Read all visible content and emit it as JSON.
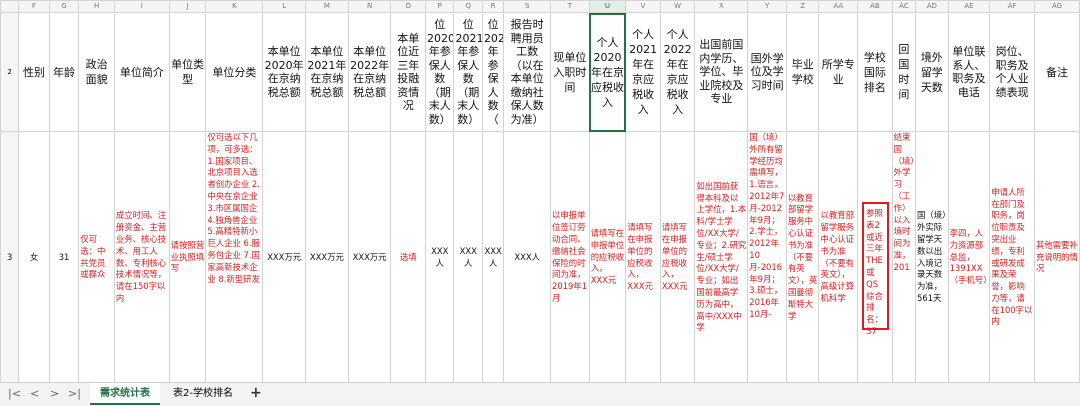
{
  "columns": [
    "F",
    "G",
    "H",
    "I",
    "J",
    "K",
    "L",
    "M",
    "N",
    "O",
    "P",
    "Q",
    "R",
    "S",
    "T",
    "U",
    "V",
    "W",
    "X",
    "Y",
    "Z",
    "AA",
    "AB",
    "AC",
    "AD",
    "AE",
    "AF",
    "AG"
  ],
  "row_numbers": [
    "2",
    "3"
  ],
  "headers": [
    "性别",
    "年龄",
    "政治面貌",
    "单位简介",
    "单位类型",
    "单位分类",
    "本单位2020年在京纳税总额",
    "本单位2021年在京纳税总额",
    "本单位2022年在京纳税总额",
    "本单位近三年投融资情况",
    "位2020年参保人数（期末人数）",
    "位2021年参保人数（期末人数）",
    "位2022年参保人数（",
    "报告时聘用员工数（以在本单位缴纳社保人数为准）",
    "现单位入职时间",
    "个人2020年在京应税收入",
    "个人2021年在京应税收入",
    "个人2022年在京应税收入",
    "出国前国内学历、学位、毕业院校及专业",
    "国外学位及学习时间",
    "毕业学校",
    "所学专业",
    "学校国际排名",
    "回国时间",
    "境外留学天数",
    "单位联系人、职务及电话",
    "岗位、职务及个人业绩表现",
    "备注"
  ],
  "data": [
    "女",
    "31",
    "仅可选：中共党员或群众",
    "成立时间、注册资金、主营业务、核心技术、用工人数、专利核心技术情况等，请在150字以内",
    "请按照营业执照填写",
    "仅可选以下几项，可多选：1.国家项目、北京项目入选者创办企业 2.中央在京企业 3.市区属国企 4.独角兽企业 5.高精特新小巨人企业 6.服务包企业 7.国家高新技术企业 8.新型研发",
    "XXX万元",
    "XXX万元",
    "XXX万元",
    "选填",
    "XXX人",
    "XXX人",
    "XXX人",
    "XXX人",
    "以申报单位签订劳动合同、缴纳社会保险的时间为准，2019年1月",
    "请填写在申报单位的应税收入，XXX元",
    "请填写在申报单位的应税收入，XXX元",
    "请填写在申报单位的应税收入，XXX元",
    "如出国前获得本科及以上学位，1.本科/学士学位/XX大学/专业；2.研究生/硕士学位/XX大学/专业；如出国前最高学历为高中，高中/XXX中学",
    "国（境）外所有留学经历均需填写，1.语言，2012年7月-2012年9月；2.学士，2012年10月-2016年9月；3.硕士，2016年10月-",
    "以教育部留学服务中心认证书为准（不要有英文），英国曼彻斯特大学",
    "以教育部留学服务中心认证书为准（不要有英文），高级计算机科学",
    "参照表2或近三年THE或QS综合排名：37",
    "结束国（境）外学习（工作）以入境时间为准，201",
    "国（境）外实际留学天数以出入境记录天数为准，561天",
    "李四，人力资源部总监，1391XX（手机号）",
    "申请人所在部门及职务，岗位职责及突出业绩，专利或研发成果及荣誉，影响力等，请在100字以内",
    "其他需要补充说明的情况"
  ],
  "sheet_tabs": [
    "需求统计表",
    "表2-学校排名"
  ],
  "add_sheet_label": "+",
  "nav_icons": [
    "first-sheet-icon",
    "prev-sheet-icon",
    "next-sheet-icon",
    "last-sheet-icon"
  ]
}
